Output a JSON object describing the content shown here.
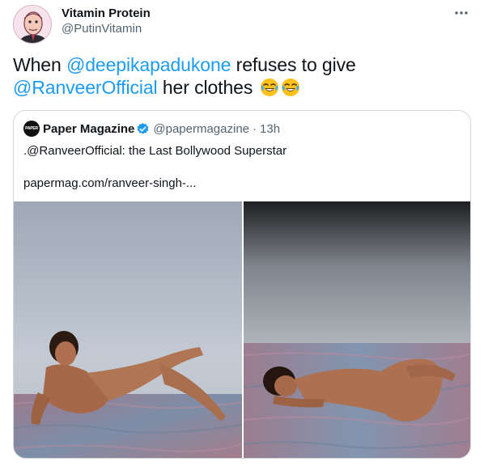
{
  "author": {
    "name": "Vitamin Protein",
    "handle": "@PutinVitamin"
  },
  "tweet": {
    "text_when": "When ",
    "mention1": "@deepikapadukone",
    "text_refuses": " refuses to give",
    "mention2": "@RanveerOfficial",
    "text_clothes": " her clothes"
  },
  "quote": {
    "avatar_text": "PAPER",
    "name": "Paper Magazine",
    "handle": "@papermagazine",
    "separator": "·",
    "time": "13h",
    "text": ".@RanveerOfficial: the Last Bollywood Superstar",
    "link": "papermag.com/ranveer-singh-..."
  },
  "icons": {
    "more": "more-horizontal-icon",
    "verified": "verified-badge-icon",
    "emoji": "joy-emoji-icon"
  },
  "colors": {
    "accent": "#1d9bf0",
    "secondary_text": "#536471",
    "border": "#cfd9de"
  }
}
